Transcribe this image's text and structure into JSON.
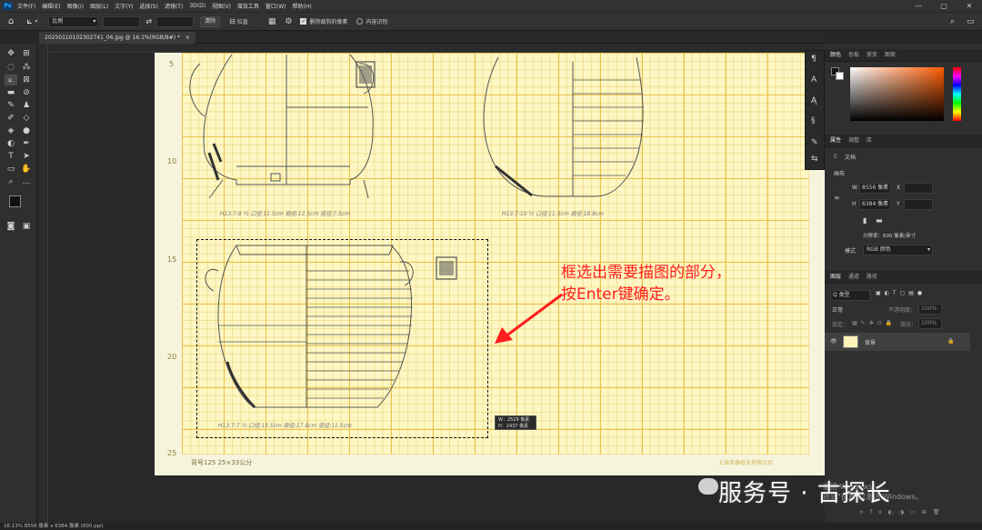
{
  "menu": {
    "app_icon": "Ps",
    "items": [
      "文件(F)",
      "编辑(E)",
      "图像(I)",
      "图层(L)",
      "文字(Y)",
      "选择(S)",
      "滤镜(T)",
      "3D(D)",
      "视图(V)",
      "增效工具",
      "窗口(W)",
      "帮助(H)"
    ]
  },
  "options": {
    "ratio_value": "比例",
    "clear_button": "清除",
    "straighten_button": "拉直",
    "delete_cropped_label": "删除裁剪的像素",
    "content_aware_label": "内容识别"
  },
  "document": {
    "tab_title": "20250110102302741_06.jpg @ 16.1%(RGB/8#) *"
  },
  "canvas": {
    "row_numbers": [
      "5",
      "10",
      "15",
      "20",
      "25"
    ],
    "selection_size": [
      "W：2529 像素",
      "H：2437 像素"
    ],
    "footer_left": "背号125   25×33公分",
    "footer_right": "上海亚泰纸业有限公司",
    "annotation": [
      "框选出需要描图的部分，",
      "按Enter键确定。"
    ],
    "notes": [
      "H13.7:8  ½  口径:11.5cm  肩径:12.5cm  底径:7.5cm",
      "H13.7:10  ½  口径:11.5cm  肩径:18.8cm",
      "H13.7:7  ½  口径:15.5cm  肩径:17.8cm  底径:11.5cm"
    ]
  },
  "right_panel": {
    "color_tabs": [
      "颜色",
      "色板",
      "渐变",
      "图案"
    ],
    "props_tabs": [
      "属性",
      "调整",
      "库"
    ],
    "doc_label": "文档",
    "canvas_label": "画布",
    "width_label": "W",
    "width_value": "8556 像素",
    "height_label": "H",
    "height_value": "6384 像素",
    "x_label": "X",
    "y_label": "Y",
    "resolution": "分辨率：600 像素/英寸",
    "mode_label": "模式",
    "mode_value": "RGB 颜色",
    "layer_tabs": [
      "图层",
      "通道",
      "路径"
    ],
    "layer_kind": "Q 类型",
    "blend_mode": "正常",
    "opacity_label": "不透明度：",
    "opacity_value": "100%",
    "lock_label": "锁定：",
    "fill_label": "填充：",
    "fill_value": "100%",
    "layer_name": "背景"
  },
  "status": {
    "text": "16.13%   8556 像素 x 6384 像素 (600 ppi)"
  },
  "watermark": {
    "text": "服务号 · 古探长",
    "win_activate_1": "激活 Windows",
    "win_activate_2": "转到\"设置\"以激活 Windows。"
  },
  "colors": {
    "accent": "#31a8ff",
    "annotation": "#ff1e1e",
    "grid": "#e9c34b"
  }
}
